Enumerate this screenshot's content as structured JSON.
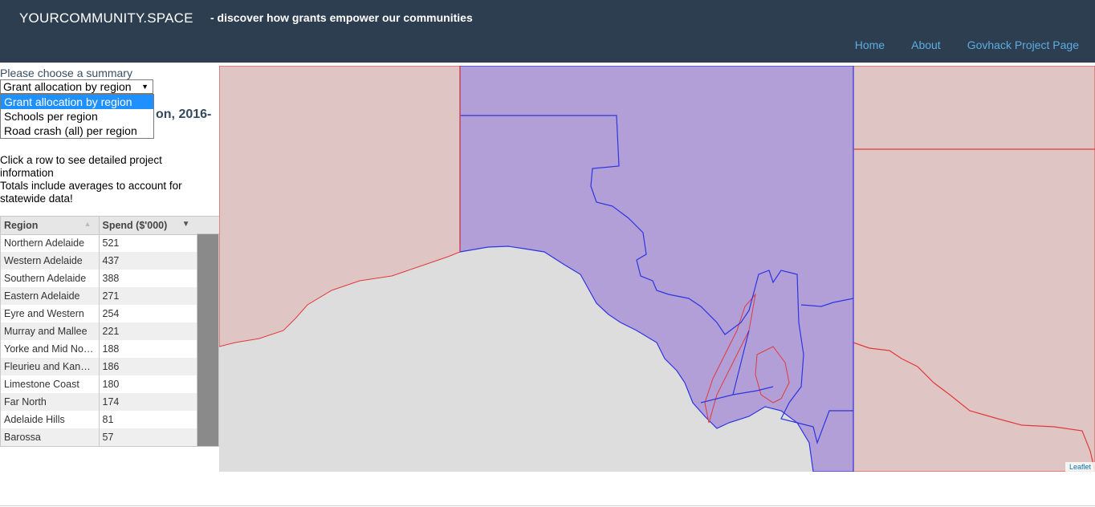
{
  "header": {
    "brand": "YOURCOMMUNITY.SPACE",
    "tagline": "- discover how grants empower our communities",
    "nav": [
      "Home",
      "About",
      "Govhack Project Page"
    ]
  },
  "summary": {
    "label": "Please choose a summary",
    "selected": "Grant allocation by region",
    "options": [
      "Grant allocation by region",
      "Schools per region",
      "Road crash (all) per region"
    ],
    "heading_visible": "on, 2016-"
  },
  "info": {
    "line1": "Click a row to see detailed project information",
    "line2": "Totals include averages to account for statewide data!"
  },
  "table": {
    "columns": [
      "Region",
      "Spend ($'000)"
    ],
    "rows": [
      {
        "region": "Northern Adelaide",
        "spend": "521"
      },
      {
        "region": "Western Adelaide",
        "spend": "437"
      },
      {
        "region": "Southern Adelaide",
        "spend": "388"
      },
      {
        "region": "Eastern Adelaide",
        "spend": "271"
      },
      {
        "region": "Eyre and Western",
        "spend": "254"
      },
      {
        "region": "Murray and Mallee",
        "spend": "221"
      },
      {
        "region": "Yorke and Mid No…",
        "spend": "188"
      },
      {
        "region": "Fleurieu and Kan…",
        "spend": "186"
      },
      {
        "region": "Limestone Coast",
        "spend": "180"
      },
      {
        "region": "Far North",
        "spend": "174"
      },
      {
        "region": "Adelaide Hills",
        "spend": "81"
      },
      {
        "region": "Barossa",
        "spend": "57"
      }
    ]
  },
  "map": {
    "attribution": "Leaflet",
    "colors": {
      "sea": "#dddddd",
      "land": "#e0c5c5",
      "highlight": "#b39fd8",
      "region_border": "#2b35e0",
      "state_border": "#e03a3a"
    }
  }
}
